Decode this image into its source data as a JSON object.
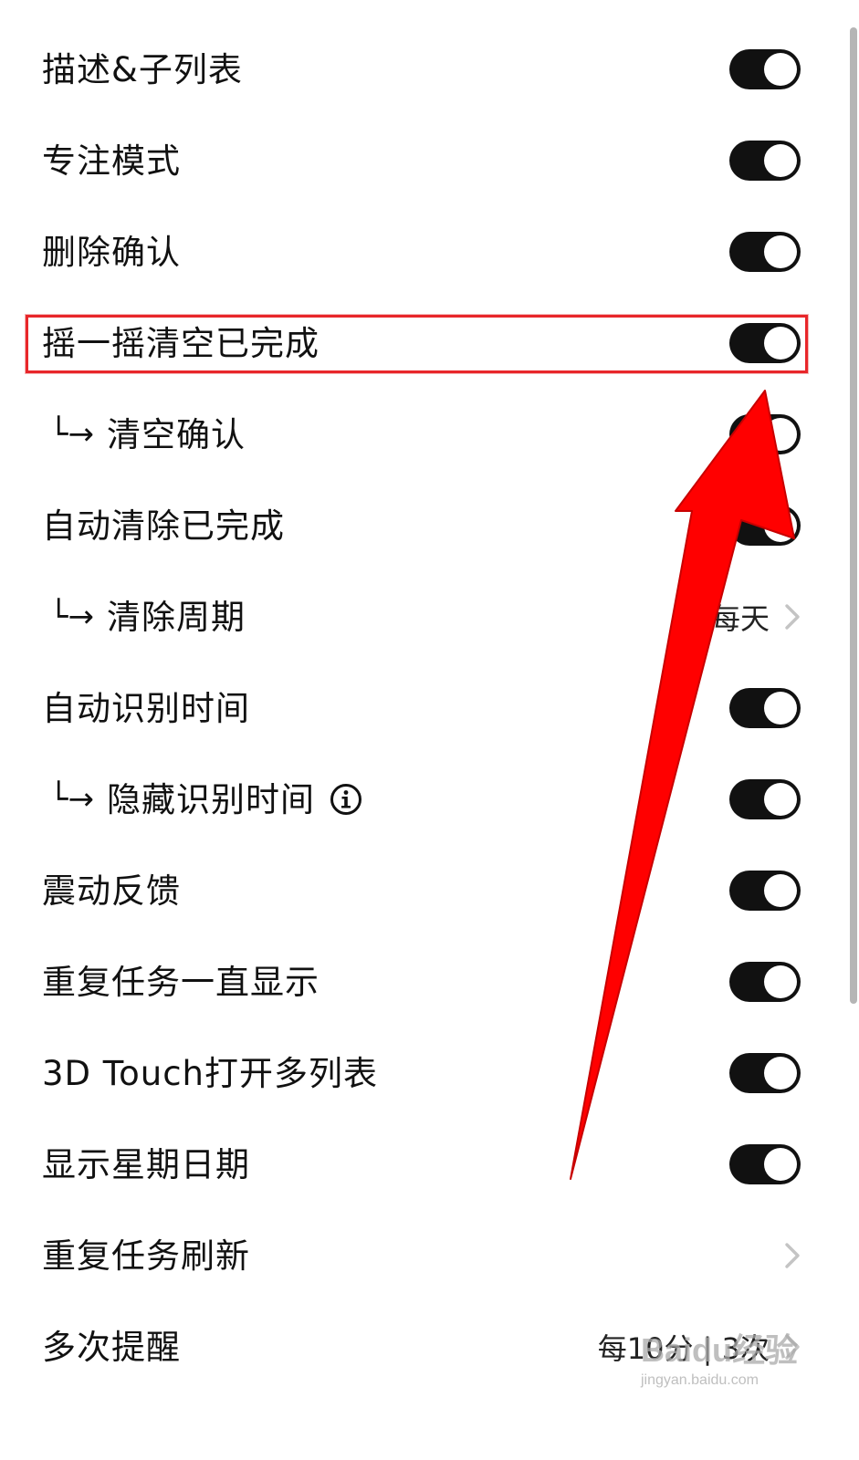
{
  "settings": {
    "rows": [
      {
        "label": "描述&子列表",
        "sub": false,
        "control": "toggle",
        "on": true
      },
      {
        "label": "专注模式",
        "sub": false,
        "control": "toggle",
        "on": true
      },
      {
        "label": "删除确认",
        "sub": false,
        "control": "toggle",
        "on": true
      },
      {
        "label": "摇一摇清空已完成",
        "sub": false,
        "control": "toggle",
        "on": true,
        "highlighted": true
      },
      {
        "label": "清空确认",
        "sub": true,
        "prefix": "└→",
        "control": "toggle",
        "on": true
      },
      {
        "label": "自动清除已完成",
        "sub": false,
        "control": "toggle",
        "on": true
      },
      {
        "label": "清除周期",
        "sub": true,
        "prefix": "└→",
        "control": "disclosure",
        "value": "每天"
      },
      {
        "label": "自动识别时间",
        "sub": false,
        "control": "toggle",
        "on": true
      },
      {
        "label": "隐藏识别时间",
        "sub": true,
        "prefix": "└→",
        "control": "toggle",
        "on": true,
        "info_icon": true
      },
      {
        "label": "震动反馈",
        "sub": false,
        "control": "toggle",
        "on": true
      },
      {
        "label": "重复任务一直显示",
        "sub": false,
        "control": "toggle",
        "on": true
      },
      {
        "label": "3D Touch打开多列表",
        "sub": false,
        "control": "toggle",
        "on": true
      },
      {
        "label": "显示星期日期",
        "sub": false,
        "control": "toggle",
        "on": true
      },
      {
        "label": "重复任务刷新",
        "sub": false,
        "control": "disclosure",
        "value": ""
      },
      {
        "label": "多次提醒",
        "sub": false,
        "control": "disclosure",
        "value": "每10分 | 3次"
      }
    ]
  },
  "icons": {
    "info": "info-circle-icon",
    "chevron": "chevron-right-icon"
  },
  "annotation": {
    "highlight_color": "#e8262a",
    "arrow_color": "#ff0000"
  },
  "watermark": {
    "brand": "Baidu经验",
    "url": "jingyan.baidu.com"
  },
  "colors": {
    "toggle_on": "#111111",
    "knob": "#ffffff",
    "chevron": "#c4c4c4"
  }
}
